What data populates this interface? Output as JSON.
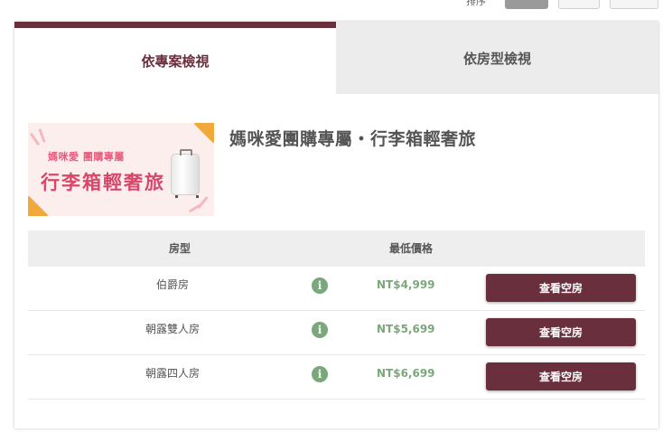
{
  "toolbar": {
    "label": "排序",
    "buttons": [
      "",
      "",
      ""
    ]
  },
  "tabs": [
    {
      "label": "依專案檢視",
      "active": true
    },
    {
      "label": "依房型檢視",
      "active": false
    }
  ],
  "banner": {
    "brand": "媽咪愛 團購專屬",
    "headline": "行李箱輕奢旅"
  },
  "package": {
    "title": "媽咪愛團購專屬・行李箱輕奢旅"
  },
  "table": {
    "headers": {
      "room_type": "房型",
      "lowest_price": "最低價格"
    },
    "rows": [
      {
        "room": "伯爵房",
        "price": "NT$4,999",
        "button": "查看空房"
      },
      {
        "room": "朝露雙人房",
        "price": "NT$5,699",
        "button": "查看空房"
      },
      {
        "room": "朝露四人房",
        "price": "NT$6,699",
        "button": "查看空房"
      }
    ]
  },
  "colors": {
    "accent": "#6a2f3c",
    "price": "#7aa87a",
    "tab_inactive_bg": "#ececec"
  }
}
